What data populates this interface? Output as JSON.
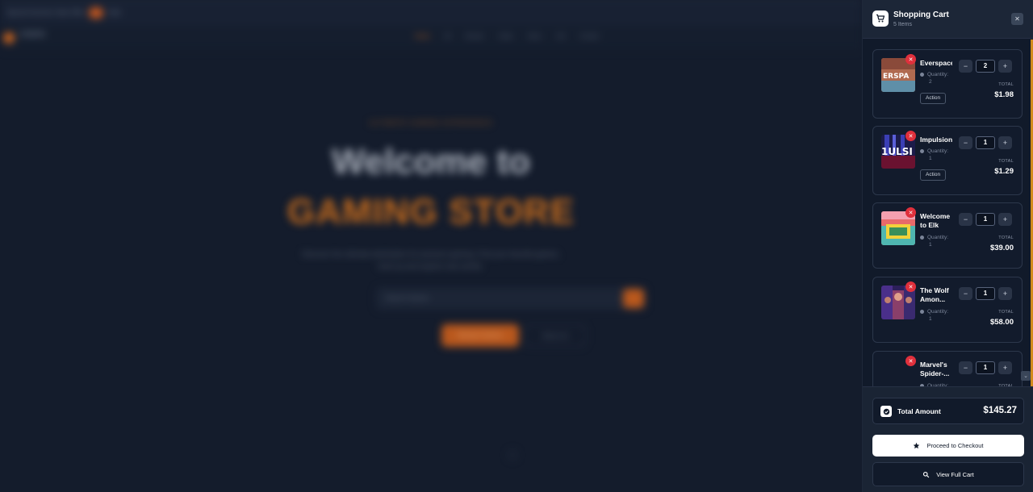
{
  "background": {
    "topbar": {
      "text": "Special Summer Sale Offer",
      "badge": "%",
      "text2": "Sale"
    },
    "logo_text": "GAMING",
    "menu": [
      "Home",
      "All",
      "Browse",
      "Deals",
      "News",
      "Hot",
      "Contact"
    ],
    "tagline": "ULTIMATE GAMING EXPERIENCE",
    "headline_1": "Welcome to",
    "headline_2": "GAMING STORE",
    "paragraph": "Discover the ultimate destination for premium gaming. Find your favorite games, level up and explore new worlds.",
    "search_placeholder": "Search Games",
    "button_primary": "Browse Games",
    "button_secondary": "About Us"
  },
  "cart": {
    "title": "Shopping Cart",
    "subtitle": "5 Items",
    "close_label": "✕",
    "quantity_label": "Quantity:",
    "total_label": "TOTAL",
    "items": [
      {
        "name": "Everspace",
        "quantity": "2",
        "tag": "Action",
        "total": "$1.98"
      },
      {
        "name": "Impulsion",
        "quantity": "1",
        "tag": "Action",
        "total": "$1.29"
      },
      {
        "name": "Welcome to Elk",
        "quantity": "1",
        "tag": "",
        "total": "$39.00"
      },
      {
        "name": "The Wolf Amon...",
        "quantity": "1",
        "tag": "",
        "total": "$58.00"
      },
      {
        "name": "Marvel's Spider-...",
        "quantity": "1",
        "tag": "",
        "total": ""
      }
    ],
    "summary": {
      "label": "Total Amount",
      "value": "$145.27"
    },
    "checkout_label": "Proceed to Checkout",
    "full_cart_label": "View Full Cart"
  },
  "colors": {
    "accent": "#d18a1c",
    "remove": "#e0303c",
    "panel": "#111a2a"
  }
}
